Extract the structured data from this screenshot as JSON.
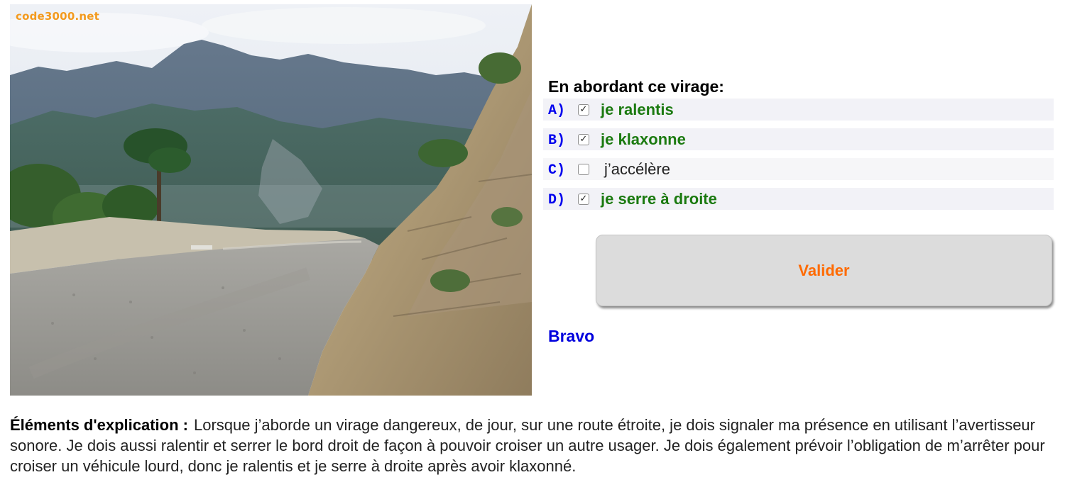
{
  "photo": {
    "watermark": "code3000.net",
    "icon": "mountain-road-photo"
  },
  "question": {
    "text": "En abordant ce virage:",
    "answers": [
      {
        "letter": "A)",
        "text": "je ralentis",
        "checked": true,
        "correct": true
      },
      {
        "letter": "B)",
        "text": "je klaxonne",
        "checked": true,
        "correct": true
      },
      {
        "letter": "C)",
        "text": "j’accélère",
        "checked": false,
        "correct": false
      },
      {
        "letter": "D)",
        "text": "je serre à droite",
        "checked": true,
        "correct": true
      }
    ]
  },
  "validate_label": "Valider",
  "result": "Bravo",
  "explanation": {
    "label": "Éléments d'explication :",
    "text": "Lorsque j’aborde un virage dangereux, de jour, sur une route étroite, je dois signaler ma présence en utilisant l’avertisseur sonore. Je dois aussi ralentir et serrer le bord droit de façon à pouvoir croiser un autre usager. Je dois également prévoir l’obligation de m’arrêter pour croiser un véhicule lourd, donc je ralentis et je serre à droite après avoir klaxonné."
  },
  "colors": {
    "correct": "#1b7a10",
    "letter": "#0000ee",
    "button_text": "#ff6a00",
    "result": "#0000dd",
    "watermark": "#f39a1e"
  }
}
